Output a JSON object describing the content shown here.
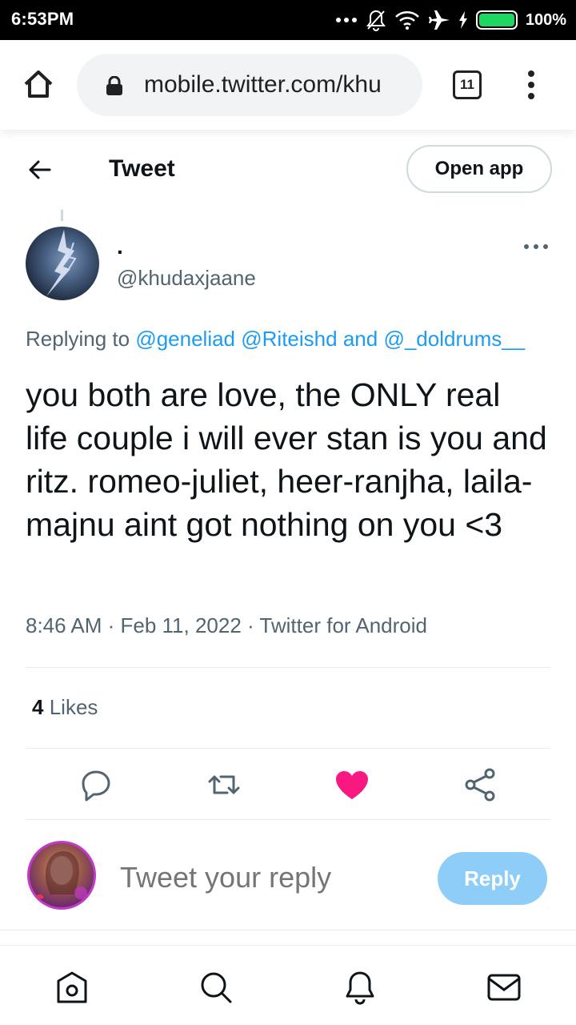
{
  "status_bar": {
    "time": "6:53PM",
    "battery_percent": "100%",
    "icons": [
      "dots-icon",
      "notifications-off-icon",
      "wifi-icon",
      "airplane-icon",
      "charging-icon",
      "battery-icon"
    ]
  },
  "browser": {
    "url": "mobile.twitter.com/khu",
    "tab_count": "11"
  },
  "header": {
    "title": "Tweet",
    "open_app_label": "Open app"
  },
  "tweet": {
    "display_name": ".",
    "handle": "@khudaxjaane",
    "replying_prefix": "Replying to",
    "mentions": [
      "@geneliad",
      "@Riteishd",
      "@_doldrums__"
    ],
    "replying_and": "and",
    "text": "you both are love, the ONLY real life couple i will ever stan is you and ritz. romeo-juliet, heer-ranjha, laila-majnu aint got nothing on you <3",
    "timestamp": "8:46 AM · Feb 11, 2022 · Twitter for Android",
    "likes_count": "4",
    "likes_label": "Likes"
  },
  "compose": {
    "placeholder": "Tweet your reply",
    "reply_label": "Reply"
  },
  "colors": {
    "accent": "#1d9bf0",
    "like": "#f91880",
    "reply_button_disabled": "#8ecdf8",
    "secondary_text": "#536471"
  }
}
